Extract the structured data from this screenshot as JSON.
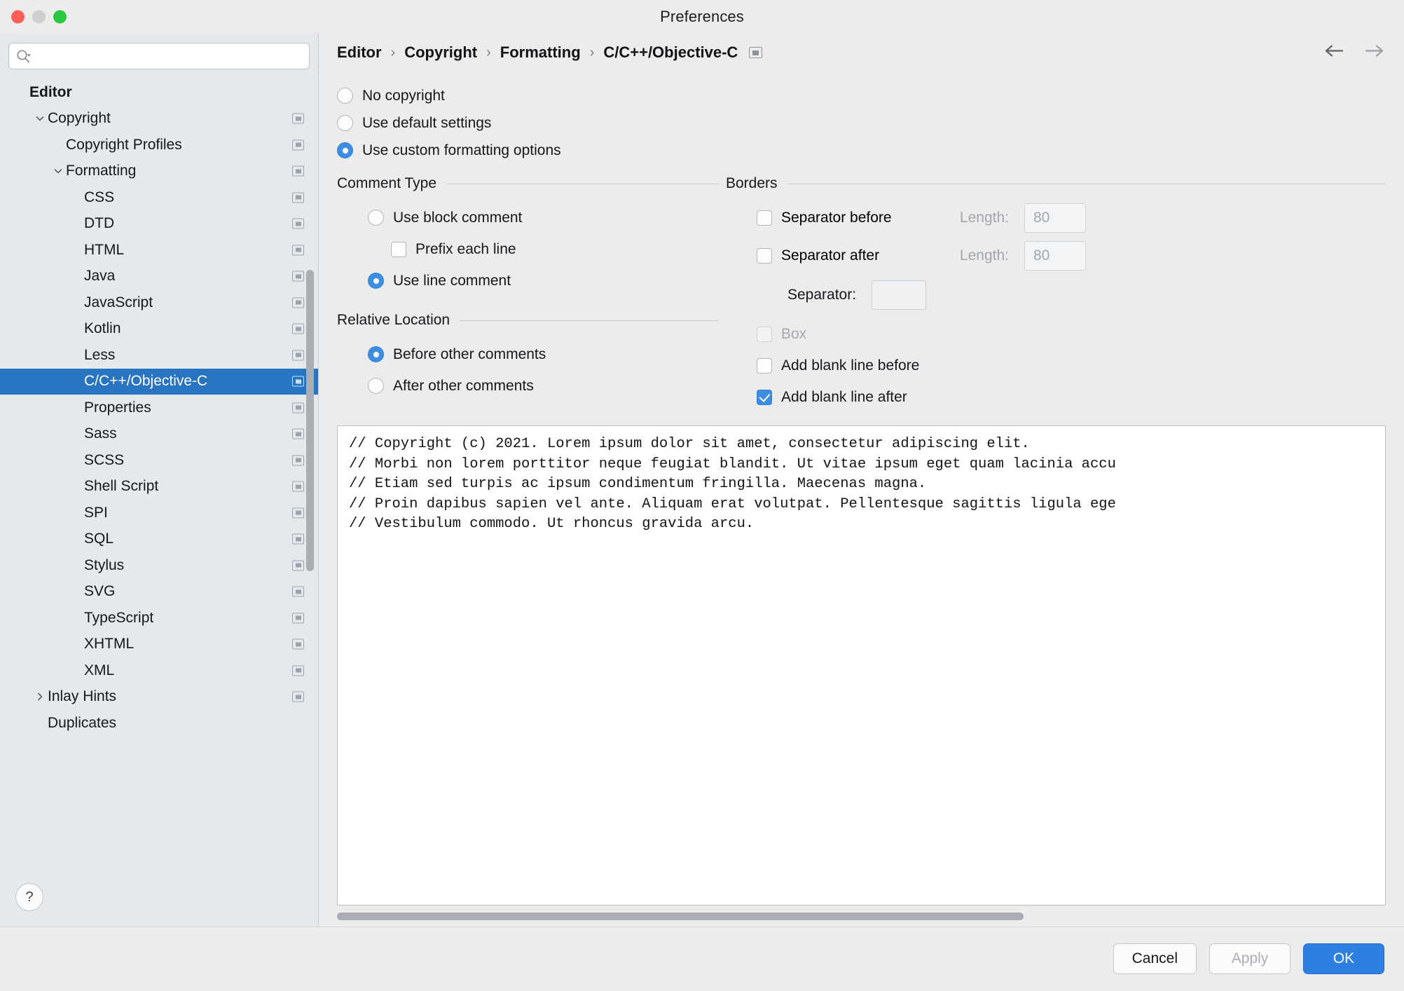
{
  "window": {
    "title": "Preferences",
    "traffic_lights": [
      "close",
      "minimize",
      "zoom"
    ]
  },
  "sidebar": {
    "search": {
      "value": "",
      "placeholder": ""
    },
    "tree": [
      {
        "label": "Editor",
        "depth": 0,
        "twisty": "",
        "bold": true,
        "badge": false,
        "selected": false
      },
      {
        "label": "Copyright",
        "depth": 1,
        "twisty": "down",
        "bold": false,
        "badge": true,
        "selected": false
      },
      {
        "label": "Copyright Profiles",
        "depth": 2,
        "twisty": "",
        "bold": false,
        "badge": true,
        "selected": false
      },
      {
        "label": "Formatting",
        "depth": 2,
        "twisty": "down",
        "bold": false,
        "badge": true,
        "selected": false
      },
      {
        "label": "CSS",
        "depth": 3,
        "twisty": "",
        "bold": false,
        "badge": true,
        "selected": false
      },
      {
        "label": "DTD",
        "depth": 3,
        "twisty": "",
        "bold": false,
        "badge": true,
        "selected": false
      },
      {
        "label": "HTML",
        "depth": 3,
        "twisty": "",
        "bold": false,
        "badge": true,
        "selected": false
      },
      {
        "label": "Java",
        "depth": 3,
        "twisty": "",
        "bold": false,
        "badge": true,
        "selected": false
      },
      {
        "label": "JavaScript",
        "depth": 3,
        "twisty": "",
        "bold": false,
        "badge": true,
        "selected": false
      },
      {
        "label": "Kotlin",
        "depth": 3,
        "twisty": "",
        "bold": false,
        "badge": true,
        "selected": false
      },
      {
        "label": "Less",
        "depth": 3,
        "twisty": "",
        "bold": false,
        "badge": true,
        "selected": false
      },
      {
        "label": "C/C++/Objective-C",
        "depth": 3,
        "twisty": "",
        "bold": false,
        "badge": true,
        "selected": true
      },
      {
        "label": "Properties",
        "depth": 3,
        "twisty": "",
        "bold": false,
        "badge": true,
        "selected": false
      },
      {
        "label": "Sass",
        "depth": 3,
        "twisty": "",
        "bold": false,
        "badge": true,
        "selected": false
      },
      {
        "label": "SCSS",
        "depth": 3,
        "twisty": "",
        "bold": false,
        "badge": true,
        "selected": false
      },
      {
        "label": "Shell Script",
        "depth": 3,
        "twisty": "",
        "bold": false,
        "badge": true,
        "selected": false
      },
      {
        "label": "SPI",
        "depth": 3,
        "twisty": "",
        "bold": false,
        "badge": true,
        "selected": false
      },
      {
        "label": "SQL",
        "depth": 3,
        "twisty": "",
        "bold": false,
        "badge": true,
        "selected": false
      },
      {
        "label": "Stylus",
        "depth": 3,
        "twisty": "",
        "bold": false,
        "badge": true,
        "selected": false
      },
      {
        "label": "SVG",
        "depth": 3,
        "twisty": "",
        "bold": false,
        "badge": true,
        "selected": false
      },
      {
        "label": "TypeScript",
        "depth": 3,
        "twisty": "",
        "bold": false,
        "badge": true,
        "selected": false
      },
      {
        "label": "XHTML",
        "depth": 3,
        "twisty": "",
        "bold": false,
        "badge": true,
        "selected": false
      },
      {
        "label": "XML",
        "depth": 3,
        "twisty": "",
        "bold": false,
        "badge": true,
        "selected": false
      },
      {
        "label": "Inlay Hints",
        "depth": 1,
        "twisty": "right",
        "bold": false,
        "badge": true,
        "selected": false
      },
      {
        "label": "Duplicates",
        "depth": 1,
        "twisty": "",
        "bold": false,
        "badge": false,
        "selected": false
      }
    ],
    "help_label": "?"
  },
  "breadcrumb": {
    "items": [
      "Editor",
      "Copyright",
      "Formatting",
      "C/C++/Objective-C"
    ],
    "separator": "›",
    "back_arrow": "←",
    "forward_arrow": "→"
  },
  "copyright_mode": {
    "options": [
      {
        "label": "No copyright",
        "selected": false
      },
      {
        "label": "Use default settings",
        "selected": false
      },
      {
        "label": "Use custom formatting options",
        "selected": true
      }
    ]
  },
  "comment_type": {
    "title": "Comment Type",
    "use_block_comment": {
      "label": "Use block comment",
      "selected": false
    },
    "prefix_each_line": {
      "label": "Prefix each line",
      "checked": false
    },
    "use_line_comment": {
      "label": "Use line comment",
      "selected": true
    }
  },
  "relative_location": {
    "title": "Relative Location",
    "options": [
      {
        "label": "Before other comments",
        "selected": true
      },
      {
        "label": "After other comments",
        "selected": false
      }
    ]
  },
  "borders": {
    "title": "Borders",
    "separator_before": {
      "label": "Separator before",
      "checked": false
    },
    "separator_before_length": {
      "label": "Length:",
      "value": "80"
    },
    "separator_after": {
      "label": "Separator after",
      "checked": false
    },
    "separator_after_length": {
      "label": "Length:",
      "value": "80"
    },
    "separator": {
      "label": "Separator:",
      "value": ""
    },
    "box": {
      "label": "Box",
      "checked": false,
      "disabled": true
    },
    "add_blank_line_before": {
      "label": "Add blank line before",
      "checked": false
    },
    "add_blank_line_after": {
      "label": "Add blank line after",
      "checked": true
    }
  },
  "preview": {
    "text": "// Copyright (c) 2021. Lorem ipsum dolor sit amet, consectetur adipiscing elit.\n// Morbi non lorem porttitor neque feugiat blandit. Ut vitae ipsum eget quam lacinia accu\n// Etiam sed turpis ac ipsum condimentum fringilla. Maecenas magna.\n// Proin dapibus sapien vel ante. Aliquam erat volutpat. Pellentesque sagittis ligula ege\n// Vestibulum commodo. Ut rhoncus gravida arcu."
  },
  "footer": {
    "cancel": "Cancel",
    "apply": "Apply",
    "ok": "OK"
  },
  "colors": {
    "accent": "#2874c0",
    "control_blue": "#3d8ee0",
    "sidebar_bg": "#e5e9ec",
    "panel_bg": "#ececec"
  }
}
